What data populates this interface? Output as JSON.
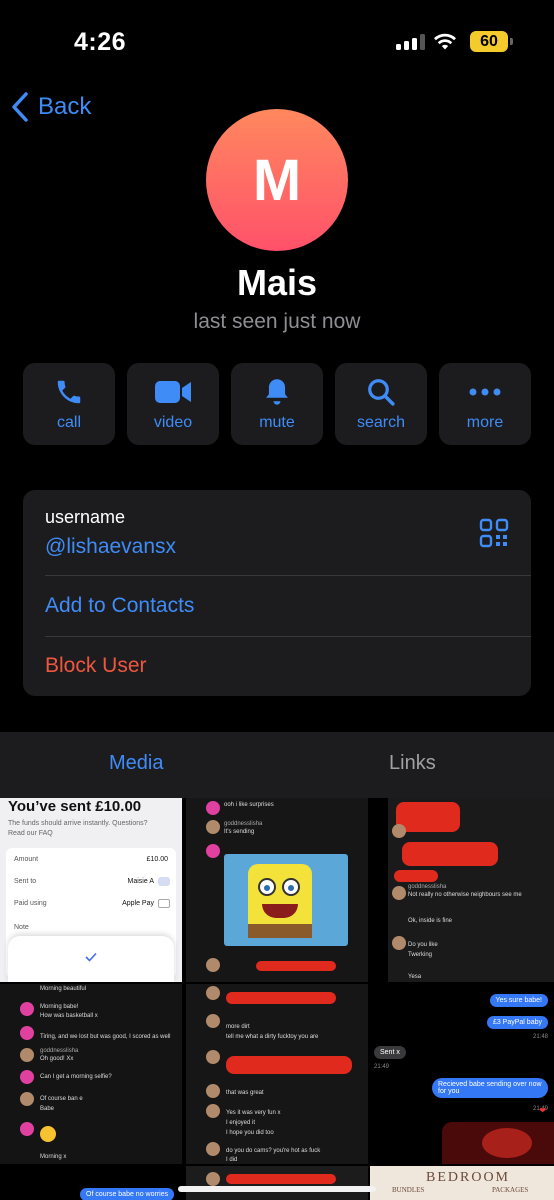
{
  "status_bar": {
    "time": "4:26",
    "battery": "60",
    "battery_color": "#f3cb2c"
  },
  "nav": {
    "back_label": "Back"
  },
  "profile": {
    "initial": "M",
    "name": "Mais",
    "last_seen": "last seen just now"
  },
  "actions": [
    {
      "label": "call",
      "icon": "phone-icon"
    },
    {
      "label": "video",
      "icon": "video-camera-icon"
    },
    {
      "label": "mute",
      "icon": "bell-icon"
    },
    {
      "label": "search",
      "icon": "search-icon"
    },
    {
      "label": "more",
      "icon": "ellipsis-icon"
    }
  ],
  "info": {
    "username_label": "username",
    "username_value": "@lishaevansx",
    "add_contacts": "Add to Contacts",
    "block_user": "Block User"
  },
  "tabs": {
    "media": "Media",
    "links": "Links"
  },
  "media_grid": {
    "item1": {
      "title": "You’ve sent £10.00",
      "subtitle": "The funds should arrive instantly. Questions?",
      "faq": "Read our FAQ",
      "rows": [
        {
          "label": "Amount",
          "value": "£10.00"
        },
        {
          "label": "Sent to",
          "value": "Maisie A"
        },
        {
          "label": "Paid using",
          "value": "Apple Pay"
        },
        {
          "label": "Note",
          "value": ""
        }
      ]
    },
    "item2": {
      "line1": "ooh i like surprises",
      "line2": "It's sending",
      "sender": "goddnesslisha"
    },
    "item3": {
      "line1": "Not really no otherwise neighbours see me",
      "line2": "Ok, inside is fine",
      "line3": "Do you like",
      "line4": "Twerking",
      "line5": "Yesa",
      "sender": "goddnesslisha"
    },
    "item4": {
      "line1": "Morning beautiful",
      "line2": "Morning babe!",
      "line3": "How was basketball x",
      "line4": "Tiring, and we lost but was good, I scored as well",
      "line5": "Oh good! Xx",
      "line6": "Can I get a morning selfie?",
      "line7": "Of course ban e",
      "line8": "Babe",
      "line9": "Morning x",
      "sender": "goddnesslisha"
    },
    "item5": {
      "line1": "more dirt",
      "line2": "tell me what a dirty fucktoy you are",
      "line3": "that was great",
      "line4": "Yes it was very fun x",
      "line5": "I enjoyed it",
      "line6": "I hope you did too",
      "line7": "do you do cams? you're hot as fuck",
      "line8": "I did",
      "sender": "goddnesslisha"
    },
    "item6": {
      "bubble1": "Yes sure babe!",
      "bubble2": "£3 PayPal baby",
      "bubble3": "Sent x",
      "bubble4": "Recieved babe sending over now for you",
      "time1": "21:48",
      "time2": "21:49",
      "time3": "21:49"
    },
    "item7": {
      "bubble": "Of course babe no worries"
    },
    "item8": {
      "title": "BEDROOM",
      "sub1": "BUNDLES",
      "sub2": "PACKAGES"
    }
  }
}
